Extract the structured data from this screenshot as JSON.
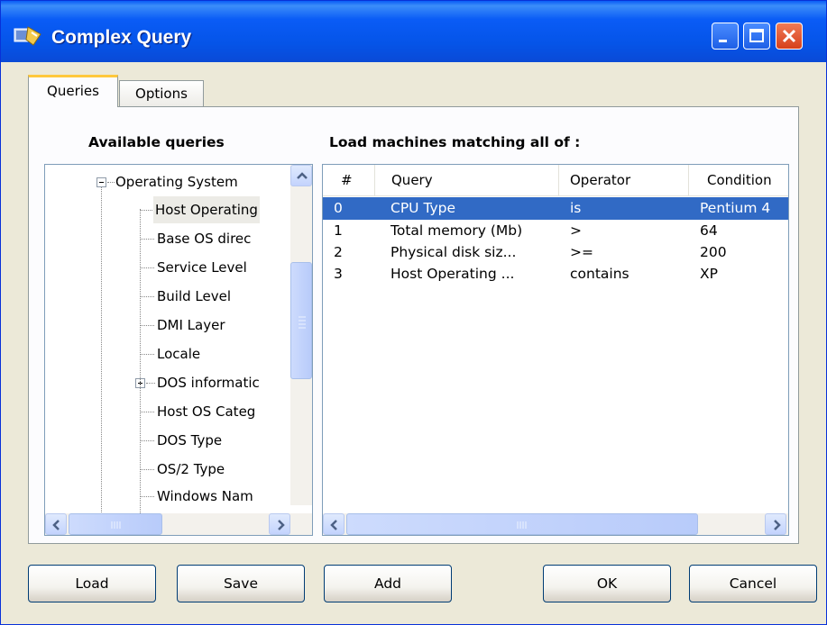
{
  "window": {
    "title": "Complex Query"
  },
  "tabs": [
    {
      "label": "Queries",
      "active": true
    },
    {
      "label": "Options",
      "active": false
    }
  ],
  "available": {
    "heading": "Available queries",
    "items": [
      {
        "label": "Operating System",
        "expander": "minus",
        "level": 0
      },
      {
        "label": "Host Operating",
        "level": 1,
        "selected": true
      },
      {
        "label": "Base OS direc",
        "level": 1
      },
      {
        "label": "Service Level",
        "level": 1
      },
      {
        "label": "Build Level",
        "level": 1
      },
      {
        "label": "DMI Layer",
        "level": 1
      },
      {
        "label": "Locale",
        "level": 1
      },
      {
        "label": "DOS informatic",
        "expander": "plus",
        "level": 1
      },
      {
        "label": "Host OS Categ",
        "level": 1
      },
      {
        "label": "DOS Type",
        "level": 1
      },
      {
        "label": "OS/2 Type",
        "level": 1
      },
      {
        "label": "Windows Nam",
        "level": 1
      }
    ]
  },
  "matching": {
    "heading": "Load machines matching all of :",
    "columns": [
      "#",
      "Query",
      "Operator",
      "Condition"
    ],
    "rows": [
      {
        "num": "0",
        "query": "CPU Type",
        "operator": "is",
        "condition": "Pentium 4",
        "selected": true
      },
      {
        "num": "1",
        "query": "Total memory (Mb)",
        "operator": ">",
        "condition": "64"
      },
      {
        "num": "2",
        "query": "Physical disk siz...",
        "operator": ">=",
        "condition": "200"
      },
      {
        "num": "3",
        "query": "Host Operating ...",
        "operator": "contains",
        "condition": "XP"
      }
    ]
  },
  "buttons": {
    "load": "Load",
    "save": "Save",
    "add": "Add",
    "ok": "OK",
    "cancel": "Cancel"
  },
  "colors": {
    "titlebar": "#0a5cf6",
    "selection": "#316ac5",
    "dialog_bg": "#ece9d8"
  }
}
